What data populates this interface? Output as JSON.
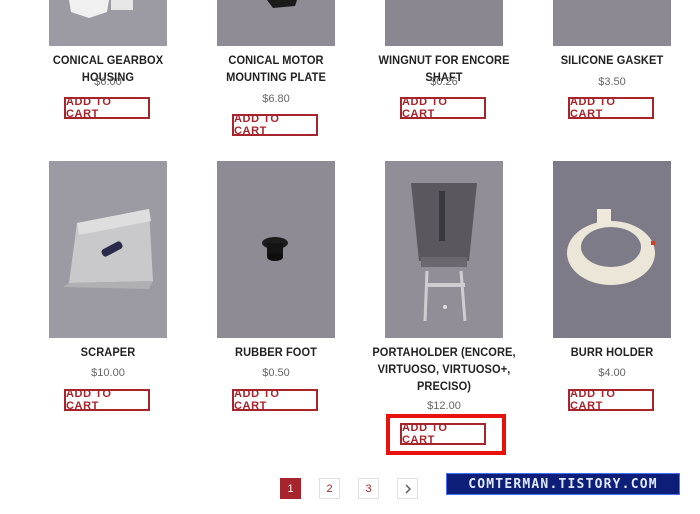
{
  "colors": {
    "accent": "#a8242c",
    "highlight": "#e8120c",
    "image_bg": "#8e8b95"
  },
  "row1": [
    {
      "title": "CONICAL GEARBOX HOUSING",
      "price": "$6.00",
      "button": "ADD TO CART"
    },
    {
      "title": "CONICAL MOTOR MOUNTING PLATE",
      "price": "$6.80",
      "button": "ADD TO CART"
    },
    {
      "title": "WINGNUT FOR ENCORE SHAFT",
      "price": "$0.26",
      "button": "ADD TO CART"
    },
    {
      "title": "SILICONE GASKET",
      "price": "$3.50",
      "button": "ADD TO CART"
    }
  ],
  "row2": [
    {
      "title": "SCRAPER",
      "price": "$10.00",
      "button": "ADD TO CART"
    },
    {
      "title": "RUBBER FOOT",
      "price": "$0.50",
      "button": "ADD TO CART"
    },
    {
      "title": "PORTAHOLDER (ENCORE, VIRTUOSO, VIRTUOSO+, PRECISO)",
      "price": "$12.00",
      "button": "ADD TO CART"
    },
    {
      "title": "BURR HOLDER",
      "price": "$4.00",
      "button": "ADD TO CART"
    }
  ],
  "pagination": {
    "pages": [
      "1",
      "2",
      "3"
    ],
    "current": "1",
    "next_icon": "chevron-right-icon"
  },
  "watermark": "COMTERMAN.TISTORY.COM"
}
